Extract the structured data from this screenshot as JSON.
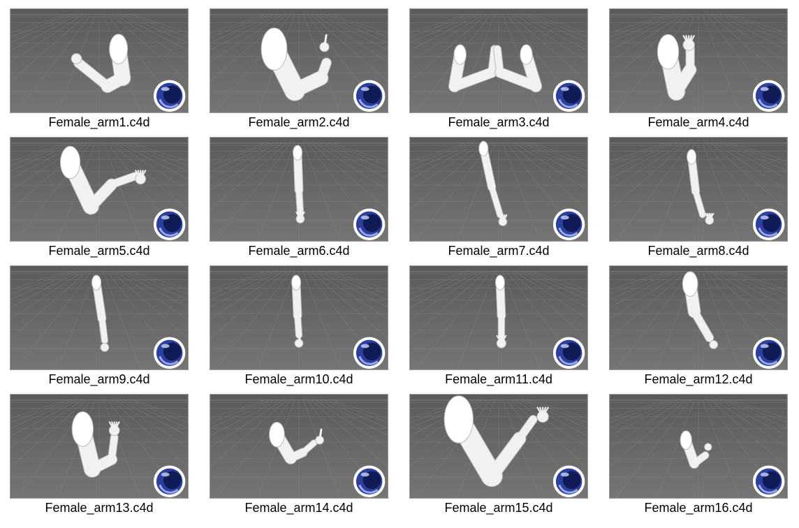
{
  "window": {
    "type": "file-thumbnail-grid"
  },
  "files": [
    {
      "name": "Female_arm1.c4d",
      "icon": "cinema4d-logo-icon",
      "pose": "fist-raised"
    },
    {
      "name": "Female_arm2.c4d",
      "icon": "cinema4d-logo-icon",
      "pose": "finger-pointing-up"
    },
    {
      "name": "Female_arm3.c4d",
      "icon": "cinema4d-logo-icon",
      "pose": "hands-together"
    },
    {
      "name": "Female_arm4.c4d",
      "icon": "cinema4d-logo-icon",
      "pose": "open-hand-raised"
    },
    {
      "name": "Female_arm5.c4d",
      "icon": "cinema4d-logo-icon",
      "pose": "graceful-hand"
    },
    {
      "name": "Female_arm6.c4d",
      "icon": "cinema4d-logo-icon",
      "pose": "hanging-straight"
    },
    {
      "name": "Female_arm7.c4d",
      "icon": "cinema4d-logo-icon",
      "pose": "hanging-angled"
    },
    {
      "name": "Female_arm8.c4d",
      "icon": "cinema4d-logo-icon",
      "pose": "hanging-bent-wrist"
    },
    {
      "name": "Female_arm9.c4d",
      "icon": "cinema4d-logo-icon",
      "pose": "hanging-fist"
    },
    {
      "name": "Female_arm10.c4d",
      "icon": "cinema4d-logo-icon",
      "pose": "hanging-pointing"
    },
    {
      "name": "Female_arm11.c4d",
      "icon": "cinema4d-logo-icon",
      "pose": "hanging-open-hand"
    },
    {
      "name": "Female_arm12.c4d",
      "icon": "cinema4d-logo-icon",
      "pose": "hanging-curved"
    },
    {
      "name": "Female_arm13.c4d",
      "icon": "cinema4d-logo-icon",
      "pose": "raised-hand-up"
    },
    {
      "name": "Female_arm14.c4d",
      "icon": "cinema4d-logo-icon",
      "pose": "pointing-sideways"
    },
    {
      "name": "Female_arm15.c4d",
      "icon": "cinema4d-logo-icon",
      "pose": "graceful-fingers"
    },
    {
      "name": "Female_arm16.c4d",
      "icon": "cinema4d-logo-icon",
      "pose": "small-fist"
    }
  ],
  "colors": {
    "viewport_top": "#5a5a5a",
    "viewport_bottom": "#757575",
    "grid_line": "#8a8a8a",
    "horizon": "#9c9c9c",
    "arm_fill": "#f1f1f1",
    "arm_stroke": "#b8b8b8",
    "logo_ring": "#ffffff",
    "logo_blue": "#2b3f9e",
    "logo_dark": "#101a55"
  }
}
